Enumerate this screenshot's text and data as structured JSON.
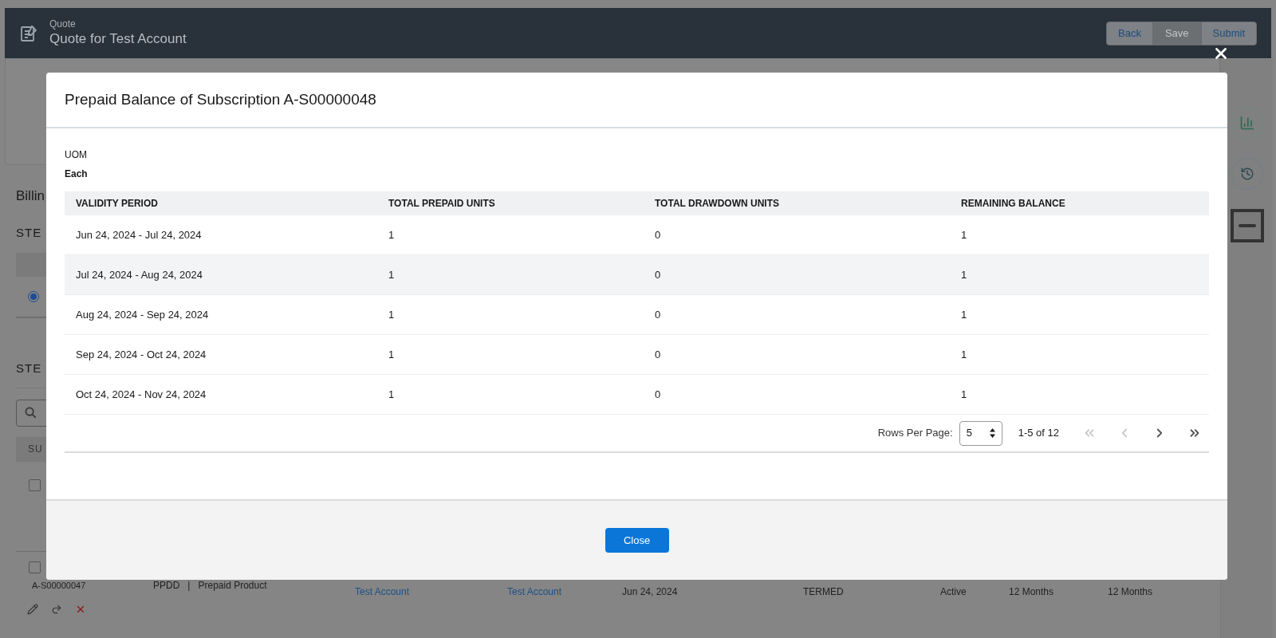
{
  "header": {
    "object_label": "Quote",
    "title": "Quote for Test Account",
    "buttons": [
      {
        "label": "Back",
        "disabled": false
      },
      {
        "label": "Save",
        "disabled": true
      },
      {
        "label": "Submit",
        "disabled": false
      }
    ]
  },
  "background": {
    "section_title": "Billin",
    "step_1": "STE",
    "step_2": "STE",
    "column_1": "SU",
    "radio_selected": true,
    "first_row_checked": false,
    "row": {
      "checked": false,
      "id": "A-S00000047",
      "product_code": "PPDD",
      "separator": "|",
      "product": "Prepaid Product",
      "bill_to": "Test Account",
      "sold_to": "Test Account",
      "date": "Jun 24, 2024",
      "term_type": "TERMED",
      "status": "Active",
      "term": "12 Months",
      "renewal_term": "12 Months"
    }
  },
  "modal": {
    "title": "Prepaid Balance of Subscription A-S00000048",
    "uom_label": "UOM",
    "uom_value": "Each",
    "table": {
      "columns": [
        "VALIDITY PERIOD",
        "TOTAL PREPAID UNITS",
        "TOTAL DRAWDOWN UNITS",
        "REMAINING BALANCE"
      ],
      "rows": [
        {
          "highlighted": false,
          "cells": [
            "Jun 24, 2024 - Jul 24, 2024",
            "1",
            "0",
            "1"
          ]
        },
        {
          "highlighted": true,
          "cells": [
            "Jul 24, 2024 - Aug 24, 2024",
            "1",
            "0",
            "1"
          ]
        },
        {
          "highlighted": false,
          "cells": [
            "Aug 24, 2024 - Sep 24, 2024",
            "1",
            "0",
            "1"
          ]
        },
        {
          "highlighted": false,
          "cells": [
            "Sep 24, 2024 - Oct 24, 2024",
            "1",
            "0",
            "1"
          ]
        },
        {
          "highlighted": false,
          "cells": [
            "Oct 24, 2024 - Nov 24, 2024",
            "1",
            "0",
            "1"
          ]
        }
      ]
    },
    "pagination": {
      "rows_per_page_label": "Rows Per Page:",
      "rows_per_page": "5",
      "range": "1-5 of 12",
      "first_disabled": true,
      "previous_disabled": true,
      "next_disabled": false,
      "last_disabled": false
    },
    "close_button": "Close"
  }
}
